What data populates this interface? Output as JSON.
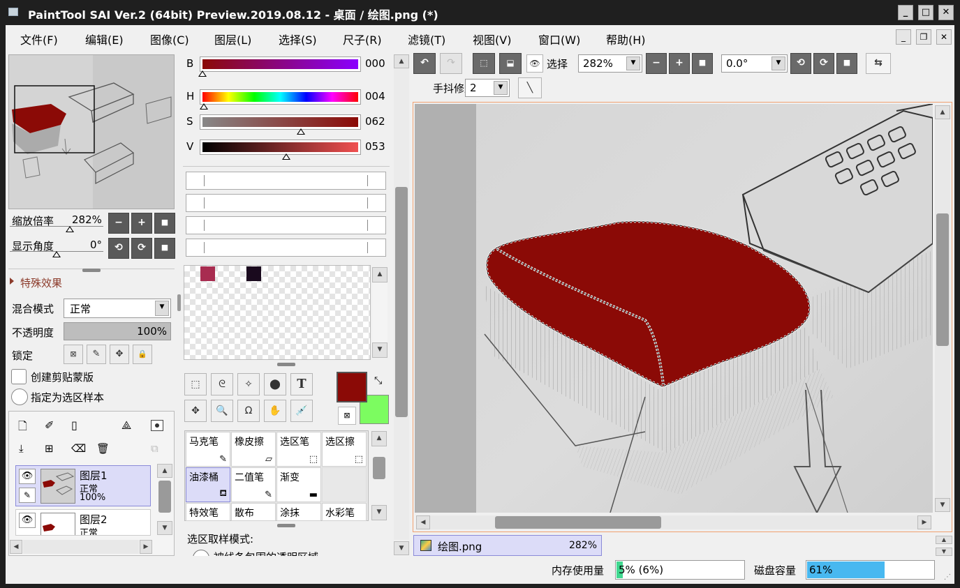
{
  "window": {
    "title": "PaintTool SAI Ver.2 (64bit) Preview.2019.08.12 - 桌面 / 绘图.png (*)",
    "minimize": "_",
    "maximize": "□",
    "close": "✕"
  },
  "menu": {
    "items": [
      "文件(F)",
      "编辑(E)",
      "图像(C)",
      "图层(L)",
      "选择(S)",
      "尺子(R)",
      "滤镜(T)",
      "视图(V)",
      "窗口(W)",
      "帮助(H)"
    ],
    "mdi_min": "_",
    "mdi_restore": "❐",
    "mdi_close": "✕"
  },
  "navigator": {
    "zoom_label": "缩放倍率",
    "zoom_value": "282%",
    "angle_label": "显示角度",
    "angle_value": "0°",
    "minus": "−",
    "plus": "+",
    "reset": "■"
  },
  "layer_props": {
    "effects_label": "特殊效果",
    "blend_label": "混合模式",
    "blend_value": "正常",
    "opacity_label": "不透明度",
    "opacity_value": "100%",
    "lock_label": "锁定",
    "clip_label": "创建剪贴蒙版",
    "sample_label": "指定为选区样本"
  },
  "layers": [
    {
      "name": "图层1",
      "mode": "正常",
      "opacity": "100%"
    },
    {
      "name": "图层2",
      "mode": "正常"
    }
  ],
  "color": {
    "rows": [
      {
        "label": "B",
        "value": "000",
        "pos": 0.0
      },
      {
        "label": "H",
        "value": "004",
        "pos": 0.01
      },
      {
        "label": "S",
        "value": "062",
        "pos": 0.62
      },
      {
        "label": "V",
        "value": "053",
        "pos": 0.53
      }
    ],
    "swatches": [
      "#a82c50",
      "#1a0a1e"
    ],
    "primary": "#8b0a06",
    "secondary": "#7cfc60"
  },
  "tools": {
    "cells": [
      {
        "label": "马克笔"
      },
      {
        "label": "橡皮擦"
      },
      {
        "label": "选区笔"
      },
      {
        "label": "选区擦"
      },
      {
        "label": "油漆桶"
      },
      {
        "label": "二值笔"
      },
      {
        "label": "渐变"
      },
      {
        "label": ""
      },
      {
        "label": "特效笔"
      },
      {
        "label": "散布"
      },
      {
        "label": "涂抹"
      },
      {
        "label": "水彩笔"
      }
    ],
    "selected": "油漆桶"
  },
  "bucket": {
    "mode_label": "选区取样模式:",
    "option": "被线条包围的透明区域"
  },
  "canvas_toolbar": {
    "select_label": "选择",
    "zoom": "282%",
    "angle": "0.0°",
    "stabilizer_label": "手抖修正",
    "stabilizer": "2"
  },
  "docs": [
    {
      "name": "绘图.png",
      "zoom": "282%"
    }
  ],
  "status": {
    "memory_label": "内存使用量",
    "memory_value": "5% (6%)",
    "memory_pct": 5,
    "disk_label": "磁盘容量",
    "disk_value": "61%",
    "disk_pct": 61
  }
}
